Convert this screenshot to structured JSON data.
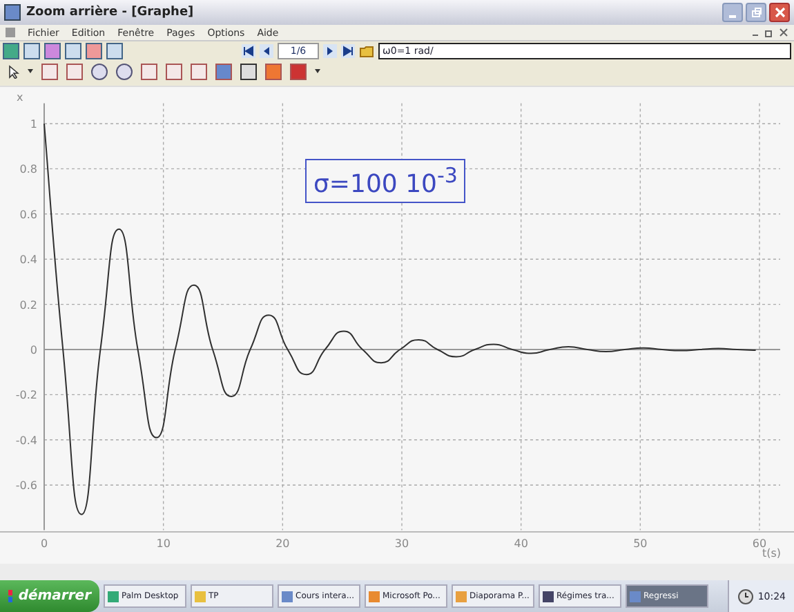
{
  "window": {
    "title": "Zoom arrière - [Graphe]"
  },
  "menu": [
    "Fichier",
    "Edition",
    "Fenêtre",
    "Pages",
    "Options",
    "Aide"
  ],
  "toolbar": {
    "page_field": "1/6",
    "parameter_field": "ω0=1 rad/"
  },
  "graph": {
    "label": "σ=100 10$^{-3}$",
    "chart_data": {
      "type": "line",
      "xlabel": "t(s)",
      "xlim": [
        0,
        60
      ],
      "ylim": [
        -0.8,
        1.09
      ],
      "grid": true,
      "xticks": [
        0,
        10,
        20,
        30,
        40,
        50,
        60
      ],
      "yticks": [
        1,
        0.8,
        0.6,
        0.4,
        0.2,
        0,
        -0.2,
        -0.4,
        -0.6
      ],
      "x": [
        0,
        1.571,
        3.142,
        4.712,
        6.283,
        7.854,
        9.425,
        10.996,
        12.566,
        14.137,
        15.708,
        17.279,
        18.85,
        20.42,
        21.991,
        23.562,
        25.133,
        26.704,
        28.274,
        29.845,
        31.416,
        32.987,
        34.558,
        36.128,
        37.699,
        39.27,
        40.841,
        42.412,
        43.982,
        45.553,
        47.124,
        48.695,
        50.265,
        51.836,
        53.407,
        54.978,
        56.549,
        58.119,
        59.69
      ],
      "series": [
        {
          "name": "x",
          "color": "#303030",
          "values": [
            1,
            0,
            -0.73,
            0,
            0.533,
            0,
            -0.39,
            0,
            0.285,
            0,
            -0.208,
            0,
            0.152,
            0,
            -0.111,
            0,
            0.081,
            0,
            -0.059,
            0,
            0.043,
            0,
            -0.032,
            0,
            0.023,
            0,
            -0.017,
            0,
            0.012,
            0,
            -0.009,
            0,
            0.007,
            0,
            -0.005,
            0,
            0.004,
            0,
            -0.003
          ]
        }
      ]
    }
  },
  "taskbar": {
    "start": "démarrer",
    "clock": "10:24",
    "items": [
      {
        "label": "Palm Desktop",
        "selected": false
      },
      {
        "label": "TP",
        "selected": false
      },
      {
        "label": "Cours intera...",
        "selected": false
      },
      {
        "label": "Microsoft Po...",
        "selected": false
      },
      {
        "label": "Diaporama P...",
        "selected": false
      },
      {
        "label": "Régimes tra...",
        "selected": false
      },
      {
        "label": "Regressi",
        "selected": true
      }
    ]
  }
}
